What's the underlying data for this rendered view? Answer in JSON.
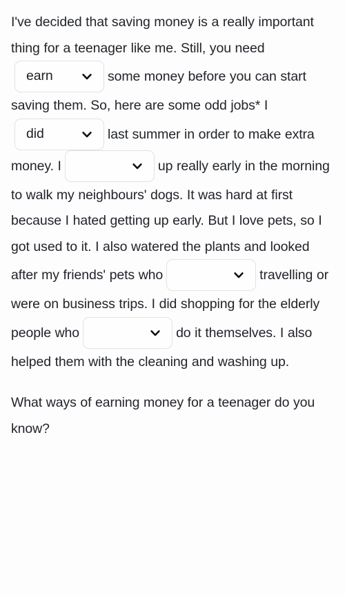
{
  "exercise": {
    "type": "fill-in-the-blank-cloze",
    "background_color": "#fdfdfd",
    "text_color": "#21242a",
    "dropdown_border_color": "#e2e2e2",
    "chevron_icon": "chevron-down-icon",
    "paragraphs": [
      {
        "id": "paragraph-1",
        "nodes": [
          {
            "kind": "text",
            "value": "I've decided that saving money is a really important thing for a teenager like me. Still, you need"
          },
          {
            "kind": "dropdown",
            "id": "dropdown-1",
            "value": "earn",
            "placeholder": ""
          },
          {
            "kind": "text",
            "value": "some money before you can start saving them. So, here are some odd jobs* I"
          },
          {
            "kind": "dropdown",
            "id": "dropdown-2",
            "value": "did",
            "placeholder": ""
          },
          {
            "kind": "text",
            "value": "last summer in order to make extra money. I"
          },
          {
            "kind": "dropdown",
            "id": "dropdown-3",
            "value": "",
            "placeholder": ""
          },
          {
            "kind": "text",
            "value": "up really early in the morning to walk my neighbours' dogs. It was hard at first because I hated getting up early. But I love pets, so I got used to it. I also watered the plants and looked after my friends' pets who"
          },
          {
            "kind": "dropdown",
            "id": "dropdown-4",
            "value": "",
            "placeholder": ""
          },
          {
            "kind": "text",
            "value": "travelling or were on business trips. I did shopping for the elderly people who"
          },
          {
            "kind": "dropdown",
            "id": "dropdown-5",
            "value": "",
            "placeholder": ""
          },
          {
            "kind": "text",
            "value": "do it themselves. I also helped them with the cleaning and washing up."
          }
        ]
      },
      {
        "id": "paragraph-2",
        "nodes": [
          {
            "kind": "text",
            "value": "What ways of earning money for a teenager do you know?"
          }
        ]
      }
    ]
  }
}
